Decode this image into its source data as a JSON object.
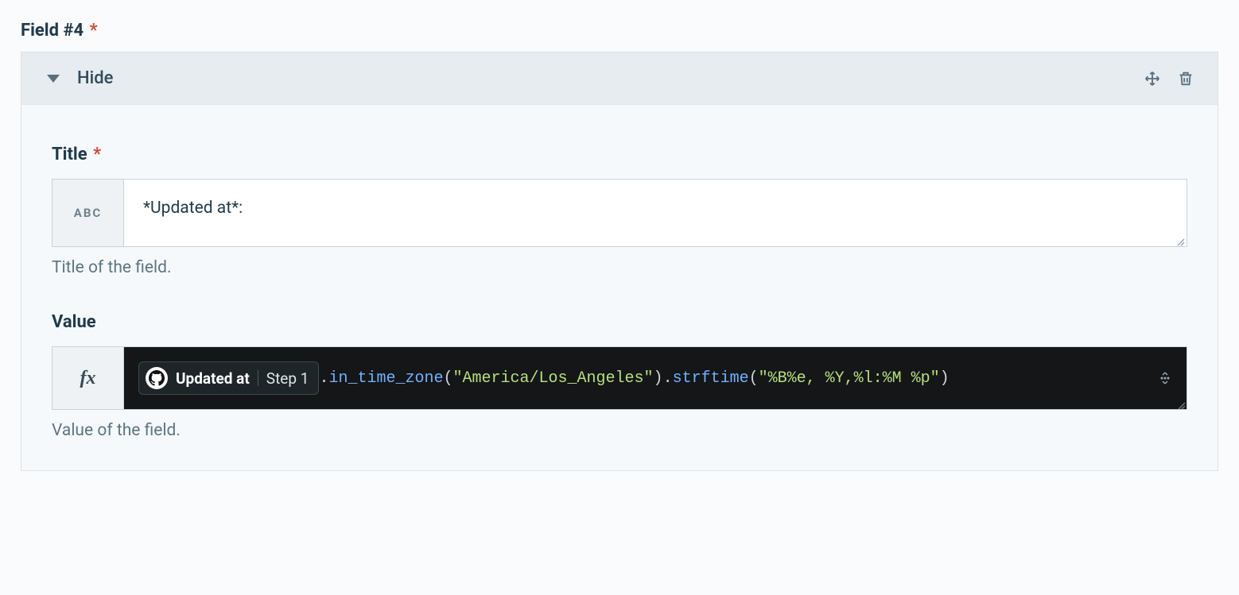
{
  "section": {
    "heading": "Field #4",
    "required_marker": "*"
  },
  "panel_header": {
    "toggle_label": "Hide"
  },
  "title_field": {
    "label": "Title",
    "prefix": "ABC",
    "value": "*Updated at*:",
    "help": "Title of the field."
  },
  "value_field": {
    "label": "Value",
    "prefix": "fx",
    "pill": {
      "source_icon": "github-icon",
      "title": "Updated at",
      "step": "Step 1"
    },
    "formula": {
      "dot1": ".",
      "method1": "in_time_zone",
      "open1": "(",
      "arg1": "\"America/Los_Angeles\"",
      "close1": ")",
      "dot2": ".",
      "method2": "strftime",
      "open2": "(",
      "arg2": "\"%B%e, %Y,%l:%M %p\"",
      "close2": ")"
    },
    "help": "Value of the field."
  }
}
